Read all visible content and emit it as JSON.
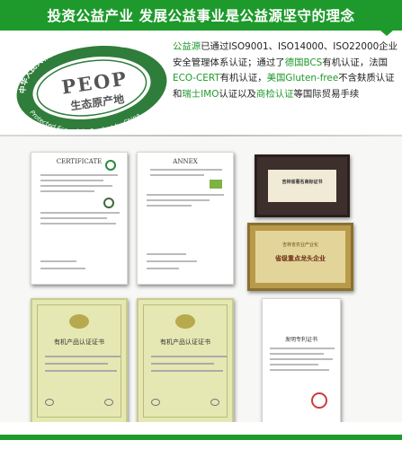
{
  "banner": {
    "title": "投资公益产业 发展公益事业是公益源坚守的理念"
  },
  "seal": {
    "top_text": "中华人民共和国生态原产地保护产品",
    "bottom_text": "Protected Eco-origin Product by China",
    "acronym": "PEOP",
    "cn_name": "生态原产地"
  },
  "description": [
    {
      "text": "公益源",
      "green": true
    },
    {
      "text": "已通过ISO9001、ISO14000、ISO22000企业安全管理体系认证；通过了",
      "green": false
    },
    {
      "text": "德国BCS",
      "green": true
    },
    {
      "text": "有机认证，法国",
      "green": false
    },
    {
      "text": "ECO-CERT",
      "green": true
    },
    {
      "text": "有机认证，",
      "green": false
    },
    {
      "text": "美国Gluten-free",
      "green": true
    },
    {
      "text": "不含麸质认证和",
      "green": false
    },
    {
      "text": "瑞士IMO",
      "green": true
    },
    {
      "text": "认证以及",
      "green": false
    },
    {
      "text": "商检认证",
      "green": true
    },
    {
      "text": "等国际贸易手续",
      "green": false
    }
  ],
  "certificates": {
    "c1_header": "CERTIFICATE",
    "c2_header": "ANNEX",
    "plaque1_title": "吉林省著名商标证书",
    "plaque2_line1": "吉林省农业产业化",
    "plaque2_line2": "省级重点龙头企业",
    "cn1_title": "有机产品认证证书",
    "cn2_title": "有机产品认证证书",
    "patent_title": "发明专利证书"
  },
  "colors": {
    "brand_green": "#1e9a2c"
  }
}
